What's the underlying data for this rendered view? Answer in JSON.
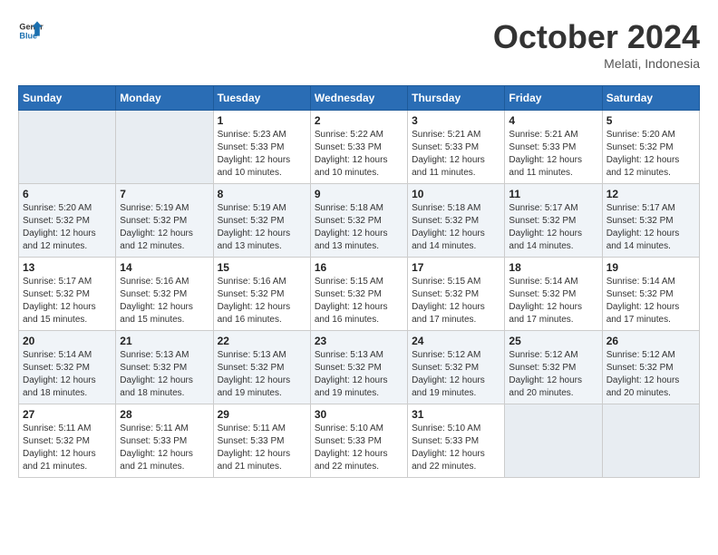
{
  "header": {
    "logo_general": "General",
    "logo_blue": "Blue",
    "month": "October 2024",
    "location": "Melati, Indonesia"
  },
  "days_of_week": [
    "Sunday",
    "Monday",
    "Tuesday",
    "Wednesday",
    "Thursday",
    "Friday",
    "Saturday"
  ],
  "weeks": [
    [
      {
        "day": "",
        "info": ""
      },
      {
        "day": "",
        "info": ""
      },
      {
        "day": "1",
        "info": "Sunrise: 5:23 AM\nSunset: 5:33 PM\nDaylight: 12 hours\nand 10 minutes."
      },
      {
        "day": "2",
        "info": "Sunrise: 5:22 AM\nSunset: 5:33 PM\nDaylight: 12 hours\nand 10 minutes."
      },
      {
        "day": "3",
        "info": "Sunrise: 5:21 AM\nSunset: 5:33 PM\nDaylight: 12 hours\nand 11 minutes."
      },
      {
        "day": "4",
        "info": "Sunrise: 5:21 AM\nSunset: 5:33 PM\nDaylight: 12 hours\nand 11 minutes."
      },
      {
        "day": "5",
        "info": "Sunrise: 5:20 AM\nSunset: 5:32 PM\nDaylight: 12 hours\nand 12 minutes."
      }
    ],
    [
      {
        "day": "6",
        "info": "Sunrise: 5:20 AM\nSunset: 5:32 PM\nDaylight: 12 hours\nand 12 minutes."
      },
      {
        "day": "7",
        "info": "Sunrise: 5:19 AM\nSunset: 5:32 PM\nDaylight: 12 hours\nand 12 minutes."
      },
      {
        "day": "8",
        "info": "Sunrise: 5:19 AM\nSunset: 5:32 PM\nDaylight: 12 hours\nand 13 minutes."
      },
      {
        "day": "9",
        "info": "Sunrise: 5:18 AM\nSunset: 5:32 PM\nDaylight: 12 hours\nand 13 minutes."
      },
      {
        "day": "10",
        "info": "Sunrise: 5:18 AM\nSunset: 5:32 PM\nDaylight: 12 hours\nand 14 minutes."
      },
      {
        "day": "11",
        "info": "Sunrise: 5:17 AM\nSunset: 5:32 PM\nDaylight: 12 hours\nand 14 minutes."
      },
      {
        "day": "12",
        "info": "Sunrise: 5:17 AM\nSunset: 5:32 PM\nDaylight: 12 hours\nand 14 minutes."
      }
    ],
    [
      {
        "day": "13",
        "info": "Sunrise: 5:17 AM\nSunset: 5:32 PM\nDaylight: 12 hours\nand 15 minutes."
      },
      {
        "day": "14",
        "info": "Sunrise: 5:16 AM\nSunset: 5:32 PM\nDaylight: 12 hours\nand 15 minutes."
      },
      {
        "day": "15",
        "info": "Sunrise: 5:16 AM\nSunset: 5:32 PM\nDaylight: 12 hours\nand 16 minutes."
      },
      {
        "day": "16",
        "info": "Sunrise: 5:15 AM\nSunset: 5:32 PM\nDaylight: 12 hours\nand 16 minutes."
      },
      {
        "day": "17",
        "info": "Sunrise: 5:15 AM\nSunset: 5:32 PM\nDaylight: 12 hours\nand 17 minutes."
      },
      {
        "day": "18",
        "info": "Sunrise: 5:14 AM\nSunset: 5:32 PM\nDaylight: 12 hours\nand 17 minutes."
      },
      {
        "day": "19",
        "info": "Sunrise: 5:14 AM\nSunset: 5:32 PM\nDaylight: 12 hours\nand 17 minutes."
      }
    ],
    [
      {
        "day": "20",
        "info": "Sunrise: 5:14 AM\nSunset: 5:32 PM\nDaylight: 12 hours\nand 18 minutes."
      },
      {
        "day": "21",
        "info": "Sunrise: 5:13 AM\nSunset: 5:32 PM\nDaylight: 12 hours\nand 18 minutes."
      },
      {
        "day": "22",
        "info": "Sunrise: 5:13 AM\nSunset: 5:32 PM\nDaylight: 12 hours\nand 19 minutes."
      },
      {
        "day": "23",
        "info": "Sunrise: 5:13 AM\nSunset: 5:32 PM\nDaylight: 12 hours\nand 19 minutes."
      },
      {
        "day": "24",
        "info": "Sunrise: 5:12 AM\nSunset: 5:32 PM\nDaylight: 12 hours\nand 19 minutes."
      },
      {
        "day": "25",
        "info": "Sunrise: 5:12 AM\nSunset: 5:32 PM\nDaylight: 12 hours\nand 20 minutes."
      },
      {
        "day": "26",
        "info": "Sunrise: 5:12 AM\nSunset: 5:32 PM\nDaylight: 12 hours\nand 20 minutes."
      }
    ],
    [
      {
        "day": "27",
        "info": "Sunrise: 5:11 AM\nSunset: 5:32 PM\nDaylight: 12 hours\nand 21 minutes."
      },
      {
        "day": "28",
        "info": "Sunrise: 5:11 AM\nSunset: 5:33 PM\nDaylight: 12 hours\nand 21 minutes."
      },
      {
        "day": "29",
        "info": "Sunrise: 5:11 AM\nSunset: 5:33 PM\nDaylight: 12 hours\nand 21 minutes."
      },
      {
        "day": "30",
        "info": "Sunrise: 5:10 AM\nSunset: 5:33 PM\nDaylight: 12 hours\nand 22 minutes."
      },
      {
        "day": "31",
        "info": "Sunrise: 5:10 AM\nSunset: 5:33 PM\nDaylight: 12 hours\nand 22 minutes."
      },
      {
        "day": "",
        "info": ""
      },
      {
        "day": "",
        "info": ""
      }
    ]
  ]
}
